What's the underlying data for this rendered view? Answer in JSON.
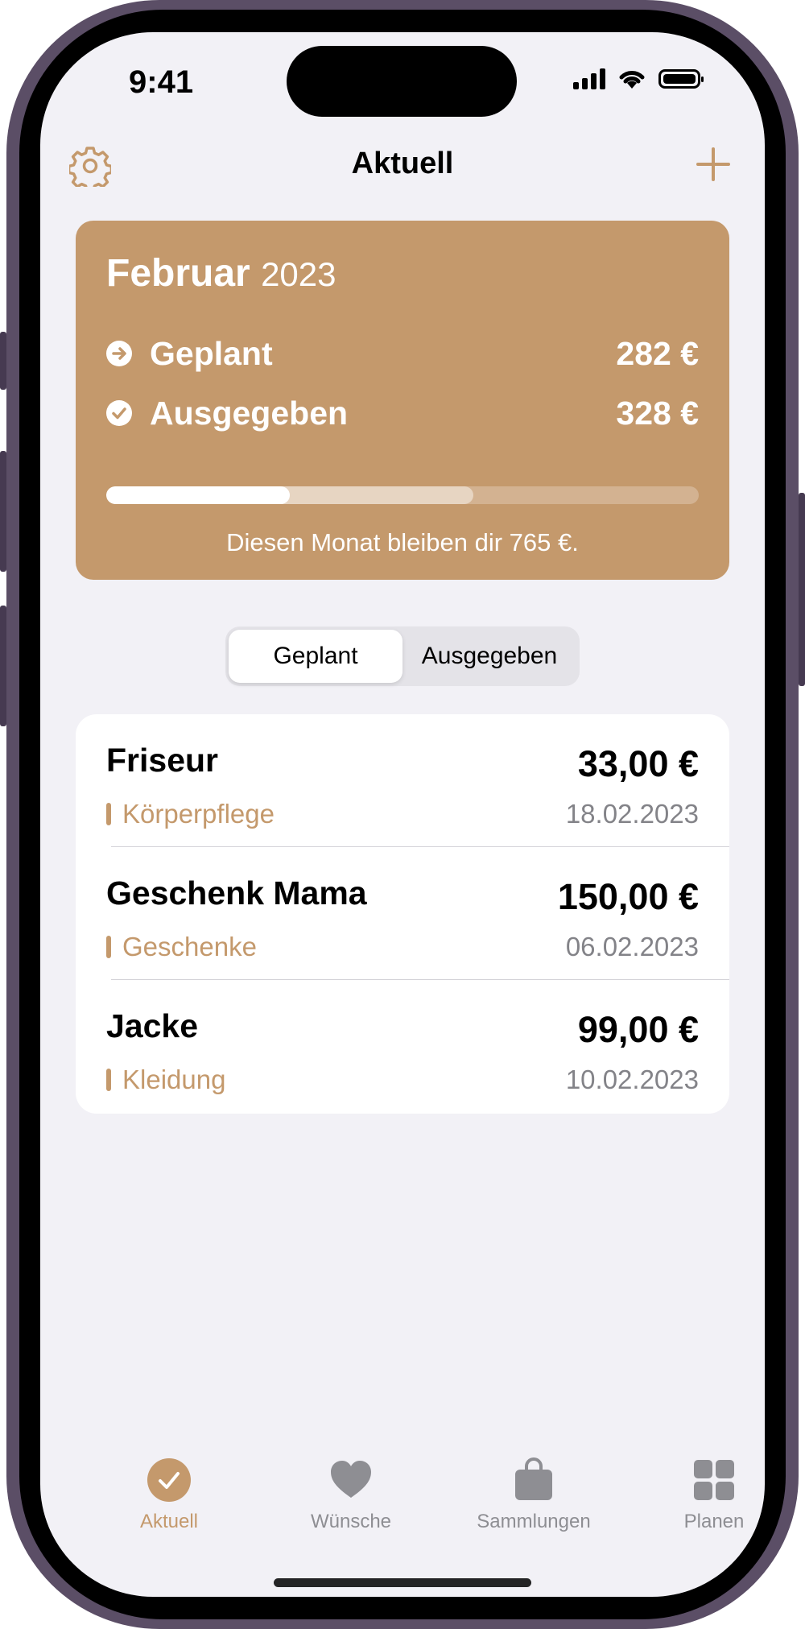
{
  "status_bar": {
    "time": "9:41"
  },
  "nav": {
    "title": "Aktuell"
  },
  "summary": {
    "month": "Februar",
    "year": "2023",
    "planned_label": "Geplant",
    "planned_value": "282 €",
    "spent_label": "Ausgegeben",
    "spent_value": "328 €",
    "note": "Diesen Monat bleiben dir 765 €.",
    "colors": {
      "card": "#c4996c",
      "accent": "#c4996c"
    }
  },
  "segmented": {
    "options": [
      "Geplant",
      "Ausgegeben"
    ],
    "selected": "Geplant"
  },
  "expenses": [
    {
      "name": "Friseur",
      "category": "Körperpflege",
      "amount": "33,00 €",
      "date": "18.02.2023"
    },
    {
      "name": "Geschenk Mama",
      "category": "Geschenke",
      "amount": "150,00 €",
      "date": "06.02.2023"
    },
    {
      "name": "Jacke",
      "category": "Kleidung",
      "amount": "99,00 €",
      "date": "10.02.2023"
    }
  ],
  "tabbar": {
    "items": [
      {
        "label": "Aktuell",
        "icon": "checkmark-circle-icon",
        "active": true
      },
      {
        "label": "Wünsche",
        "icon": "heart-icon",
        "active": false
      },
      {
        "label": "Sammlungen",
        "icon": "bag-icon",
        "active": false
      },
      {
        "label": "Planen",
        "icon": "grid-icon",
        "active": false
      }
    ]
  }
}
